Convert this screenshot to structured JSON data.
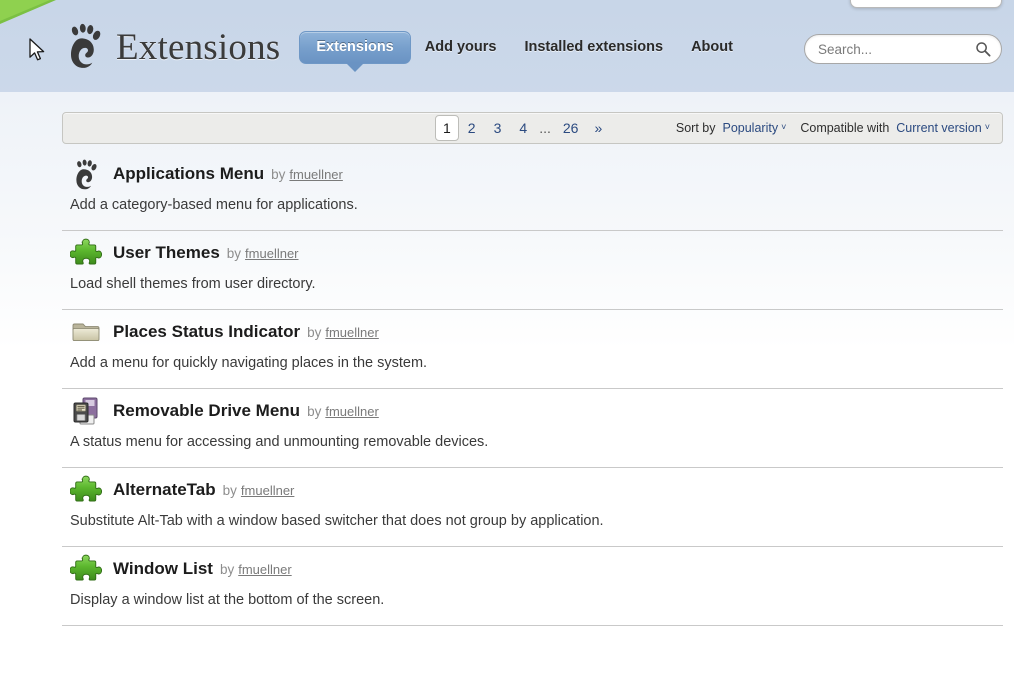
{
  "header": {
    "brand_title": "Extensions",
    "logo_icon": "gnome-foot-icon",
    "nav": [
      {
        "label": "Extensions",
        "active": true
      },
      {
        "label": "Add yours",
        "active": false
      },
      {
        "label": "Installed extensions",
        "active": false
      },
      {
        "label": "About",
        "active": false
      }
    ],
    "search": {
      "placeholder": "Search...",
      "value": "",
      "icon": "search-icon"
    }
  },
  "toolbar": {
    "pages": [
      {
        "label": "1",
        "current": true
      },
      {
        "label": "2",
        "current": false
      },
      {
        "label": "3",
        "current": false
      },
      {
        "label": "4",
        "current": false
      }
    ],
    "ellipsis": "...",
    "last_page": "26",
    "next_label": "»",
    "sort_by_label": "Sort by",
    "sort_by_value": "Popularity",
    "compatible_label": "Compatible with",
    "compatible_value": "Current version",
    "caret_glyph": "˅"
  },
  "extensions": [
    {
      "name": "Applications Menu",
      "by_label": "by",
      "author": "fmuellner",
      "description": "Add a category-based menu for applications.",
      "icon": "gnome-foot-icon"
    },
    {
      "name": "User Themes",
      "by_label": "by",
      "author": "fmuellner",
      "description": "Load shell themes from user directory.",
      "icon": "green-puzzle-piece-icon"
    },
    {
      "name": "Places Status Indicator",
      "by_label": "by",
      "author": "fmuellner",
      "description": "Add a menu for quickly navigating places in the system.",
      "icon": "folder-icon"
    },
    {
      "name": "Removable Drive Menu",
      "by_label": "by",
      "author": "fmuellner",
      "description": "A status menu for accessing and unmounting removable devices.",
      "icon": "removable-drive-icon"
    },
    {
      "name": "AlternateTab",
      "by_label": "by",
      "author": "fmuellner",
      "description": "Substitute Alt-Tab with a window based switcher that does not group by application.",
      "icon": "green-puzzle-piece-icon"
    },
    {
      "name": "Window List",
      "by_label": "by",
      "author": "fmuellner",
      "description": "Display a window list at the bottom of the screen.",
      "icon": "green-puzzle-piece-icon"
    }
  ],
  "colors": {
    "accent_blue": "#6a93c3",
    "link_blue": "#2b4a80",
    "page_bg": "#d2dced",
    "panel_bg": "#ffffff",
    "toolbar_bg": "#ececea",
    "puzzle_green": "#4ea72b",
    "folder_tan": "#d8d4b8",
    "drive_purple": "#8c6f9e"
  }
}
